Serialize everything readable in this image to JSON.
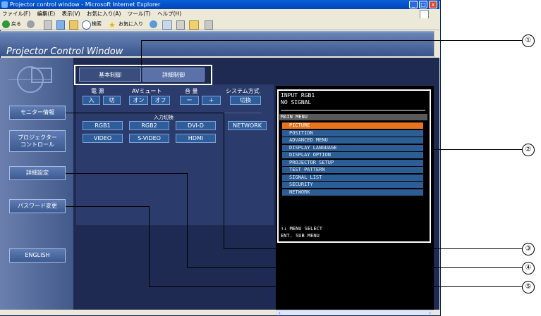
{
  "window": {
    "title": "Projector control window - Microsoft Internet Explorer",
    "minimize": "_",
    "maximize": "□",
    "close": "x"
  },
  "menubar": {
    "items": [
      "ファイル(F)",
      "編集(E)",
      "表示(V)",
      "お気に入り(A)",
      "ツール(T)",
      "ヘルプ(H)"
    ]
  },
  "toolbar": {
    "back": "戻る",
    "search": "検索",
    "favorites": "お気に入り"
  },
  "page": {
    "title": "Projector Control Window"
  },
  "sidebar": {
    "monitor": "モニター情報",
    "projector_line1": "プロジェクター",
    "projector_line2": "コントロール",
    "detail_settings": "詳細設定",
    "password_change": "パスワード変更",
    "english": "ENGLISH"
  },
  "tabs": {
    "basic": "基本制御",
    "detail": "詳細制御"
  },
  "controls": {
    "power_label": "電 源",
    "power_on": "入",
    "power_off": "切",
    "av_mute_label": "AVミュート",
    "av_on": "オン",
    "av_off": "オフ",
    "volume_label": "音 量",
    "vol_down": "ー",
    "vol_up": "＋",
    "system_label": "システム方式",
    "system_switch": "切換",
    "input_label": "入力切換",
    "inputs_row1": [
      "RGB1",
      "RGB2",
      "DVI-D",
      "NETWORK"
    ],
    "inputs_row2": [
      "VIDEO",
      "S-VIDEO",
      "HDMI"
    ]
  },
  "osd": {
    "input": "INPUT RGB1",
    "signal": "NO SIGNAL",
    "main_menu": "MAIN MENU",
    "items": [
      "PICTURE",
      "POSITION",
      "ADVANCED MENU",
      "DISPLAY LANGUAGE",
      "DISPLAY OPTION",
      "PROJECTOR SETUP",
      "TEST PATTERN",
      "SIGNAL LIST",
      "SECURITY",
      "NETWORK"
    ],
    "selected_index": 0,
    "hint1": "↑↓   MENU SELECT",
    "hint2": "ENT.  SUB MENU"
  },
  "callouts": [
    "①",
    "②",
    "③",
    "④",
    "⑤"
  ],
  "colors": {
    "selected_item": "#e8731e",
    "menu_item": "#2d5d95",
    "sidebar": "#4e6a9c"
  }
}
